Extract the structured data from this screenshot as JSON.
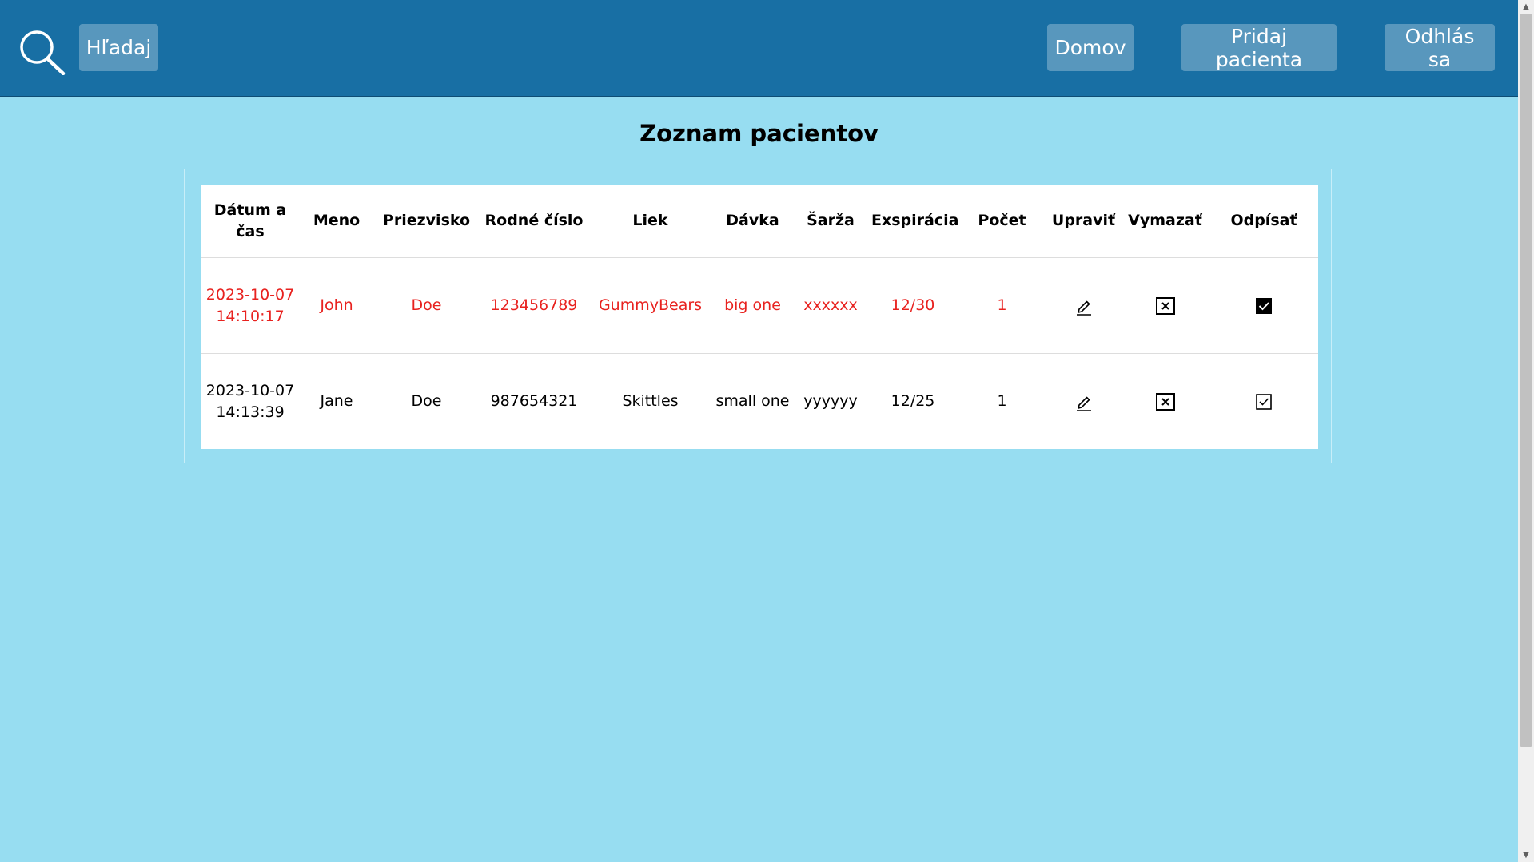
{
  "navbar": {
    "search_label": "Hľadaj",
    "home_label": "Domov",
    "add_patient_label": "Pridaj pacienta",
    "logout_label": "Odhlás sa"
  },
  "page": {
    "title": "Zoznam pacientov"
  },
  "table": {
    "headers": [
      "Dátum a čas",
      "Meno",
      "Priezvisko",
      "Rodné číslo",
      "Liek",
      "Dávka",
      "Šarža",
      "Exspirácia",
      "Počet",
      "Upraviť",
      "Vymazať",
      "Odpísať"
    ],
    "rows": [
      {
        "datetime": "2023-10-07 14:10:17",
        "first_name": "John",
        "last_name": "Doe",
        "birth_number": "123456789",
        "medicine": "GummyBears",
        "dose": "big one",
        "batch": "xxxxxx",
        "expiration": "12/30",
        "count": "1",
        "highlight": true,
        "written_off": true
      },
      {
        "datetime": "2023-10-07 14:13:39",
        "first_name": "Jane",
        "last_name": "Doe",
        "birth_number": "987654321",
        "medicine": "Skittles",
        "dose": "small one",
        "batch": "yyyyyy",
        "expiration": "12/25",
        "count": "1",
        "highlight": false,
        "written_off": false
      }
    ]
  },
  "colors": {
    "navbar_bg": "#186fa4",
    "page_bg": "#97ddf1",
    "highlight_text": "#e8221f",
    "button_bg": "rgba(255,255,255,0.28)"
  },
  "icons": {
    "search": "search-icon",
    "edit": "pencil-icon",
    "delete": "close-box-icon",
    "write_off_checked": "checkbox-checked-icon",
    "write_off_unchecked": "checkbox-unchecked-icon"
  }
}
